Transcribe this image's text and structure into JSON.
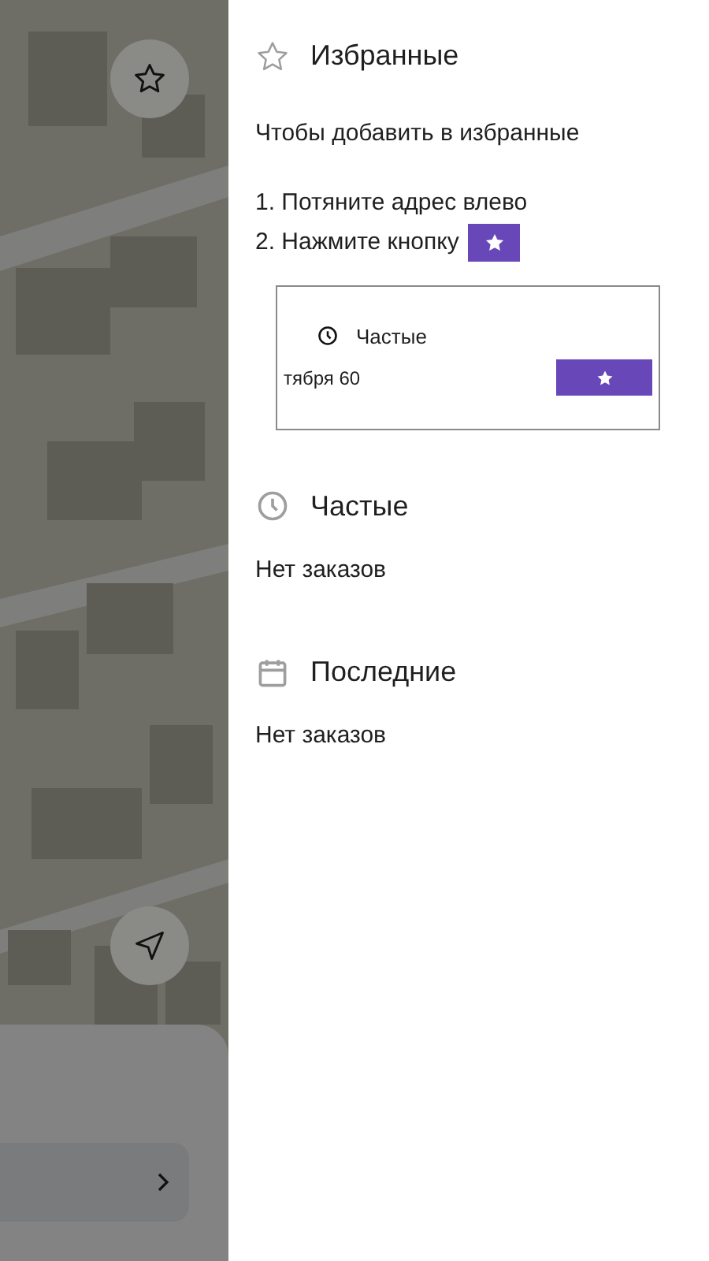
{
  "favorites": {
    "title": "Избранные",
    "hint": "Чтобы добавить в избранные",
    "steps": [
      {
        "text": "1. Потяните адрес влево",
        "star_badge": false
      },
      {
        "text": "2. Нажмите кнопку",
        "star_badge": true
      }
    ],
    "example": {
      "section": "Частые",
      "address": "тября 60"
    }
  },
  "sections": [
    {
      "kind": "frequent",
      "title": "Частые",
      "empty": "Нет заказов"
    },
    {
      "kind": "recent",
      "title": "Последние",
      "empty": "Нет заказов"
    }
  ]
}
